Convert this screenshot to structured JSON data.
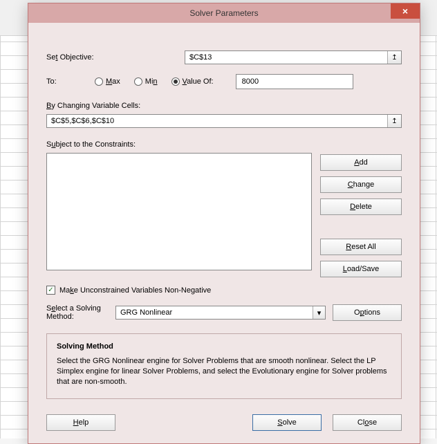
{
  "title": "Solver Parameters",
  "setObjective": {
    "label_pre": "Se",
    "label_ul": "t",
    "label_post": " Objective:",
    "value": "$C$13"
  },
  "to": {
    "label": "To:",
    "max": {
      "pre": "",
      "ul": "M",
      "post": "ax"
    },
    "min": {
      "pre": "Mi",
      "ul": "n",
      "post": ""
    },
    "valueOf": {
      "pre": "",
      "ul": "V",
      "post": "alue Of:"
    },
    "selected": "valueOf",
    "value": "8000"
  },
  "changing": {
    "pre": "",
    "ul": "B",
    "post": "y Changing Variable Cells:",
    "value": "$C$5,$C$6,$C$10"
  },
  "constraints": {
    "pre": "S",
    "ul": "u",
    "post": "bject to the Constraints:"
  },
  "buttons": {
    "add": {
      "pre": "",
      "ul": "A",
      "post": "dd"
    },
    "change": {
      "pre": "",
      "ul": "C",
      "post": "hange"
    },
    "delete": {
      "pre": "",
      "ul": "D",
      "post": "elete"
    },
    "resetAll": {
      "pre": "",
      "ul": "R",
      "post": "eset All"
    },
    "loadSave": {
      "pre": "",
      "ul": "L",
      "post": "oad/Save"
    },
    "options": {
      "pre": "O",
      "ul": "p",
      "post": "tions"
    },
    "help": {
      "pre": "",
      "ul": "H",
      "post": "elp"
    },
    "solve": {
      "pre": "",
      "ul": "S",
      "post": "olve"
    },
    "close": {
      "pre": "Cl",
      "ul": "o",
      "post": "se"
    }
  },
  "nonneg": {
    "pre": "Ma",
    "ul": "k",
    "post": "e Unconstrained Variables Non-Negative",
    "checked": true
  },
  "method": {
    "label_pre": "S",
    "label_ul": "e",
    "label_post": "lect a Solving Method:",
    "value": "GRG Nonlinear"
  },
  "info": {
    "header": "Solving Method",
    "text": "Select the GRG Nonlinear engine for Solver Problems that are smooth nonlinear. Select the LP Simplex engine for linear Solver Problems, and select the Evolutionary engine for Solver problems that are non-smooth."
  }
}
